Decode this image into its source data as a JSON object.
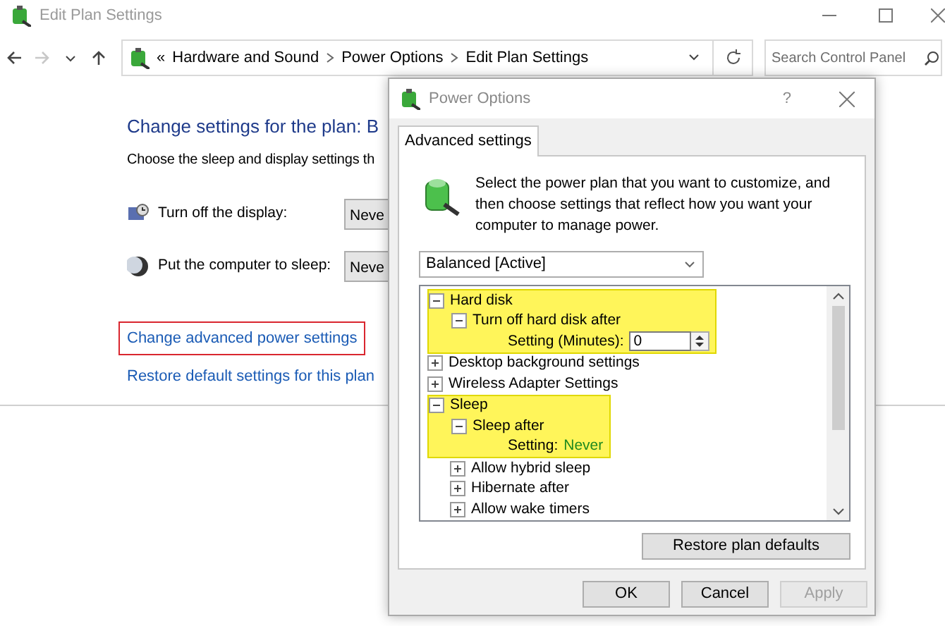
{
  "window": {
    "title": "Edit Plan Settings"
  },
  "address_bar": {
    "back_disabled": false,
    "forward_disabled": true,
    "overflow": "«",
    "crumbs": [
      "Hardware and Sound",
      "Power Options",
      "Edit Plan Settings"
    ],
    "search": {
      "placeholder": "Search Control Panel"
    }
  },
  "content": {
    "heading": "Change settings for the plan: B",
    "subtitle": "Choose the sleep and display settings th",
    "settings": [
      {
        "kind": "display",
        "label": "Turn off the display:",
        "value": "Neve"
      },
      {
        "kind": "sleep",
        "label": "Put the computer to sleep:",
        "value": "Neve"
      }
    ],
    "links": [
      {
        "text": "Change advanced power settings",
        "outlined": true
      },
      {
        "text": "Restore default settings for this plan",
        "outlined": false
      }
    ]
  },
  "dialog": {
    "title": "Power Options",
    "help": "?",
    "tabs": [
      {
        "label": "Advanced settings",
        "selected": true
      }
    ],
    "description": "Select the power plan that you want to customize, and then choose settings that reflect how you want your computer to manage power.",
    "plan": "Balanced [Active]",
    "tree": [
      {
        "kind": "group",
        "label": "Hard disk",
        "expanded": true,
        "highlighted": true,
        "children": [
          {
            "kind": "group",
            "label": "Turn off hard disk after",
            "expanded": true,
            "highlighted": true,
            "children": [
              {
                "kind": "spin",
                "label": "Setting (Minutes):",
                "value": "0",
                "highlighted": true
              }
            ]
          }
        ]
      },
      {
        "kind": "group",
        "label": "Desktop background settings",
        "expanded": false,
        "highlighted": false
      },
      {
        "kind": "group",
        "label": "Wireless Adapter Settings",
        "expanded": false,
        "highlighted": false
      },
      {
        "kind": "group",
        "label": "Sleep",
        "expanded": true,
        "highlighted": true,
        "children": [
          {
            "kind": "group",
            "label": "Sleep after",
            "expanded": true,
            "highlighted": true,
            "children": [
              {
                "kind": "value",
                "label": "Setting:",
                "value": "Never",
                "highlighted": true
              }
            ]
          },
          {
            "kind": "group",
            "label": "Allow hybrid sleep",
            "expanded": false,
            "highlighted": false
          },
          {
            "kind": "group",
            "label": "Hibernate after",
            "expanded": false,
            "highlighted": false
          },
          {
            "kind": "group",
            "label": "Allow wake timers",
            "expanded": false,
            "highlighted": false
          }
        ]
      }
    ],
    "restore_button": "Restore plan defaults",
    "buttons": [
      {
        "label": "OK",
        "disabled": false
      },
      {
        "label": "Cancel",
        "disabled": false
      },
      {
        "label": "Apply",
        "disabled": true
      }
    ]
  }
}
